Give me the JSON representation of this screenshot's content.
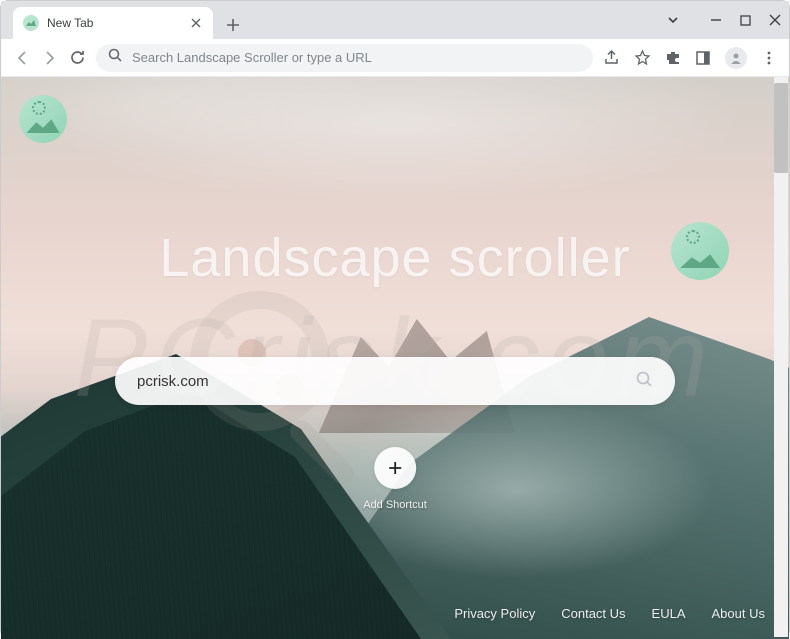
{
  "tab": {
    "title": "New Tab",
    "favicon": "landscape-extension-icon"
  },
  "omnibox": {
    "placeholder": "Search Landscape Scroller or type a URL"
  },
  "toolbar_icons": [
    "share-icon",
    "bookmark-star-icon",
    "extensions-icon",
    "sidepanel-icon",
    "profile-icon",
    "menu-dots-icon"
  ],
  "hero": {
    "title": "Landscape scroller"
  },
  "search": {
    "value": "pcrisk.com"
  },
  "shortcut": {
    "label": "Add Shortcut"
  },
  "footer": {
    "links": [
      "Privacy Policy",
      "Contact Us",
      "EULA",
      "About Us"
    ]
  },
  "watermark": {
    "text": "PCrisk.com"
  }
}
